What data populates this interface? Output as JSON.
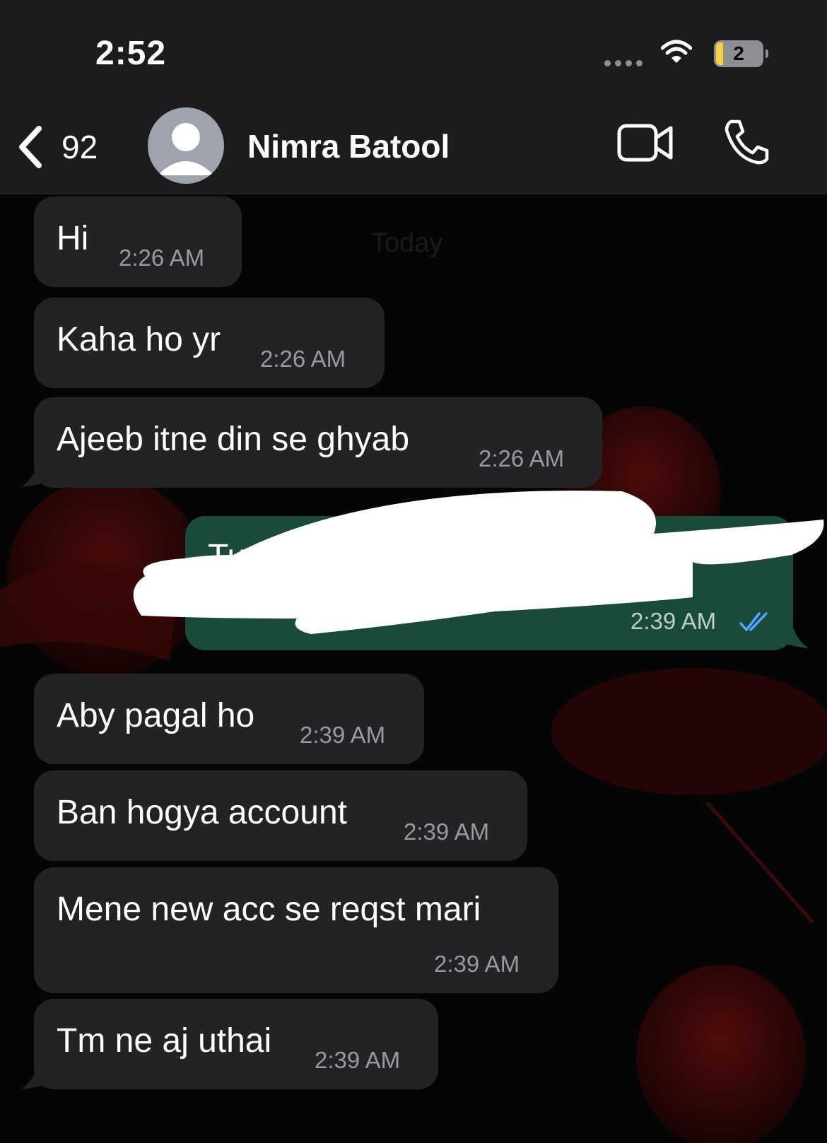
{
  "status_bar": {
    "time": "2:52",
    "battery": "2"
  },
  "header": {
    "back_count": "92",
    "contact_name": "Nimra Batool"
  },
  "chat": {
    "date_label": "Today",
    "messages": [
      {
        "direction": "incoming",
        "text": "Hi",
        "time": "2:26 AM"
      },
      {
        "direction": "incoming",
        "text": "Kaha ho yr",
        "time": "2:26 AM"
      },
      {
        "direction": "incoming",
        "text": "Ajeeb itne din se ghyab",
        "time": "2:26 AM"
      },
      {
        "direction": "outgoing",
        "text": "Tu",
        "time": "2:39 AM",
        "status": "read",
        "redacted": true
      },
      {
        "direction": "incoming",
        "text": "Aby pagal ho",
        "time": "2:39 AM"
      },
      {
        "direction": "incoming",
        "text": "Ban hogya account",
        "time": "2:39 AM"
      },
      {
        "direction": "incoming",
        "text": "Mene new acc se reqst mari",
        "time": "2:39 AM"
      },
      {
        "direction": "incoming",
        "text": "Tm ne aj uthai",
        "time": "2:39 AM"
      }
    ]
  },
  "colors": {
    "incoming_bubble": "#232325",
    "outgoing_bubble": "#1a4a3a",
    "read_ticks": "#4fa8ff",
    "header_bg": "#1c1c1e"
  },
  "icons": [
    "chevron-left-icon",
    "avatar-placeholder-icon",
    "video-camera-icon",
    "phone-icon",
    "wifi-icon",
    "battery-icon",
    "double-check-icon"
  ]
}
